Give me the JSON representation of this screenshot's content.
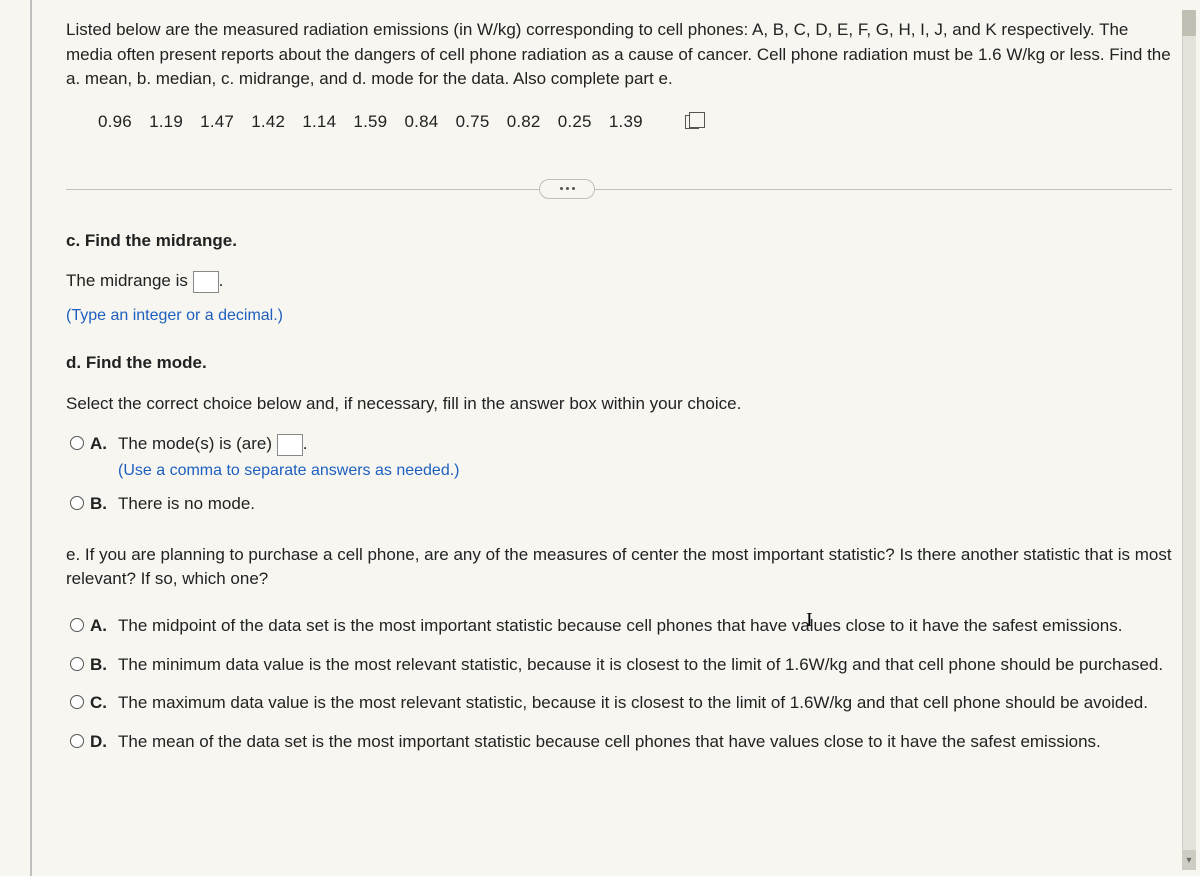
{
  "intro": "Listed below are the measured radiation emissions (in W/kg) corresponding to cell phones: A, B, C, D, E, F, G, H, I, J, and K respectively. The media often present reports about the dangers of cell phone radiation as a cause of cancer. Cell phone radiation must be 1.6 W/kg or less. Find the a. mean, b. median, c. midrange, and d. mode for the data. Also complete part e.",
  "data_values": [
    "0.96",
    "1.19",
    "1.47",
    "1.42",
    "1.14",
    "1.59",
    "0.84",
    "0.75",
    "0.82",
    "0.25",
    "1.39"
  ],
  "part_c": {
    "heading": "c. Find the midrange.",
    "statement_prefix": "The midrange is ",
    "statement_suffix": ".",
    "input_value": "",
    "hint": "(Type an integer or a decimal.)"
  },
  "part_d": {
    "heading": "d. Find the mode.",
    "instruction": "Select the correct choice below and, if necessary, fill in the answer box within your choice.",
    "choices": [
      {
        "label": "A.",
        "text_prefix": "The mode(s) is (are) ",
        "text_suffix": ".",
        "input_value": "",
        "sub": "(Use a comma to separate answers as needed.)"
      },
      {
        "label": "B.",
        "text": "There is no mode."
      }
    ]
  },
  "part_e": {
    "question": "e. If you are planning to purchase a cell phone, are any of the measures of center the most important statistic? Is there another statistic that is most relevant? If so, which one?",
    "choices": [
      {
        "label": "A.",
        "text": "The midpoint of the data set is the most important statistic because cell phones that have values close to it have the safest emissions."
      },
      {
        "label": "B.",
        "text": "The minimum data value is the most relevant statistic, because it is closest to the limit of 1.6W/kg and that cell phone should be purchased."
      },
      {
        "label": "C.",
        "text": "The maximum data value is the most relevant statistic, because it is closest to the limit of 1.6W/kg and that cell phone should be avoided."
      },
      {
        "label": "D.",
        "text": "The mean of the data set is the most important statistic because cell phones that have values close to it have the safest emissions."
      }
    ]
  }
}
